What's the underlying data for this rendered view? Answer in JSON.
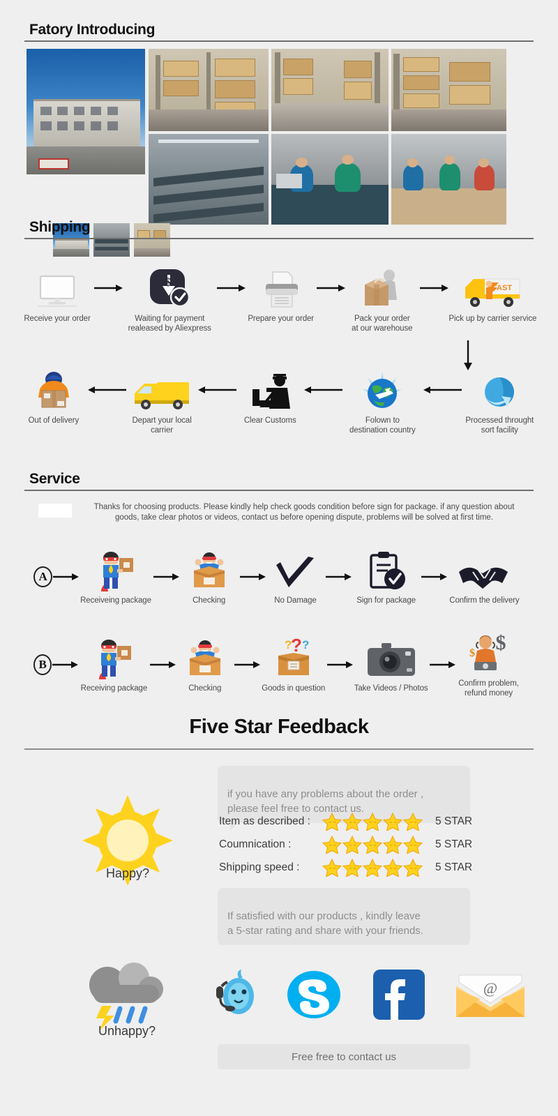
{
  "sections": {
    "factory": {
      "title": "Fatory Introducing"
    },
    "shipping": {
      "title": "Shipping"
    },
    "service": {
      "title": "Service",
      "note_line1": "Thanks for choosing products. Please kindly help check goods condition before sign for package. if any question about",
      "note_line2": "goods, take clear photos or videos, contact us before opening dispute, problems will be solved at first time."
    },
    "feedback": {
      "title": "Five Star Feedback"
    }
  },
  "shipping_flow": {
    "row1": [
      {
        "icon": "monitor-icon",
        "label": "Receive your order"
      },
      {
        "icon": "payment-icon",
        "label": "Waiting for payment\nrealeased by Aliexpress"
      },
      {
        "icon": "printer-icon",
        "label": "Prepare your order"
      },
      {
        "icon": "packing-icon",
        "label": "Pack your order\nat our warehouse"
      },
      {
        "icon": "truck-fast-icon",
        "label": "Pick up by carrier service"
      }
    ],
    "row2": [
      {
        "icon": "delivery-person-icon",
        "label": "Out of delivery"
      },
      {
        "icon": "van-icon",
        "label": "Depart your local\ncarrier"
      },
      {
        "icon": "customs-officer-icon",
        "label": "Clear Customs"
      },
      {
        "icon": "globe-plane-icon",
        "label": "Folown to\ndestination country"
      },
      {
        "icon": "sort-facility-icon",
        "label": "Processed throught\nsort facility"
      }
    ]
  },
  "service_flow": {
    "row_a": {
      "badge": "A",
      "steps": [
        {
          "icon": "hero-package-icon",
          "label": "Receiveing package"
        },
        {
          "icon": "open-box-happy-icon",
          "label": "Checking"
        },
        {
          "icon": "checkmark-icon",
          "label": "No Damage"
        },
        {
          "icon": "signed-document-icon",
          "label": "Sign for package"
        },
        {
          "icon": "handshake-icon",
          "label": "Confirm the delivery"
        }
      ]
    },
    "row_b": {
      "badge": "B",
      "steps": [
        {
          "icon": "hero-package-icon",
          "label": "Receiving package"
        },
        {
          "icon": "open-box-happy-icon",
          "label": "Checking"
        },
        {
          "icon": "question-box-icon",
          "label": "Goods in question"
        },
        {
          "icon": "camera-icon",
          "label": "Take Videos / Photos"
        },
        {
          "icon": "refund-agent-icon",
          "label": "Confirm problem,\nrefund money"
        }
      ]
    }
  },
  "feedback": {
    "happy_label": "Happy?",
    "unhappy_label": "Unhappy?",
    "bubble_top": "if you have any problems about the order ,\nplease feel free to contact us.",
    "bubble_bottom": "If satisfied with our products ,  kindly leave\na 5-star rating and share with your friends.",
    "ratings": [
      {
        "label": "Item as described :",
        "stars": 5,
        "value": "5 STAR"
      },
      {
        "label": "Coumnication :",
        "stars": 5,
        "value": "5 STAR"
      },
      {
        "label": "Shipping speed :",
        "stars": 5,
        "value": "5 STAR"
      }
    ],
    "contact_icons": [
      "aliexpress-chat-icon",
      "skype-icon",
      "facebook-icon",
      "email-icon"
    ],
    "contact_bar_text": "Free free to contact us"
  },
  "colors": {
    "background": "#efefef",
    "rule": "#6f6f6f",
    "star": "#ffd21e",
    "star_border": "#f5a623",
    "sun": "#ffd21e",
    "skype": "#00aff0",
    "facebook": "#1b5fae",
    "envelope": "#f7b23b",
    "bubble": "#e4e4e4",
    "bubble_text": "#8d8d8d"
  }
}
